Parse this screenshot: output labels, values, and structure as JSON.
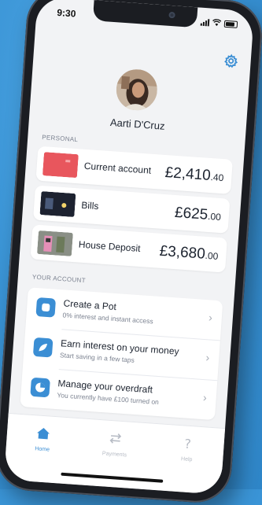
{
  "status_bar": {
    "time": "9:30"
  },
  "profile": {
    "name": "Aarti D'Cruz"
  },
  "sections": {
    "personal": "PERSONAL",
    "your_account": "YOUR ACCOUNT"
  },
  "accounts": [
    {
      "name": "Current account",
      "amount_major": "£2,410",
      "amount_minor": ".40"
    },
    {
      "name": "Bills",
      "amount_major": "£625",
      "amount_minor": ".00"
    },
    {
      "name": "House Deposit",
      "amount_major": "£3,680",
      "amount_minor": ".00"
    }
  ],
  "account_actions": [
    {
      "title": "Create a Pot",
      "subtitle": "0% interest and instant access",
      "icon": "pot-icon"
    },
    {
      "title": "Earn interest on your money",
      "subtitle": "Start saving in a few taps",
      "icon": "leaf-icon"
    },
    {
      "title": "Manage your overdraft",
      "subtitle": "You currently have £100 turned on",
      "icon": "pie-chart-icon"
    }
  ],
  "tabs": [
    {
      "label": "Home",
      "icon": "home-icon",
      "active": true
    },
    {
      "label": "Payments",
      "icon": "transfer-arrows-icon",
      "active": false
    },
    {
      "label": "Help",
      "icon": "question-icon",
      "active": false
    }
  ],
  "colors": {
    "accent": "#3b8ed4",
    "background": "#3a94d6",
    "screen": "#f2f3f5"
  }
}
